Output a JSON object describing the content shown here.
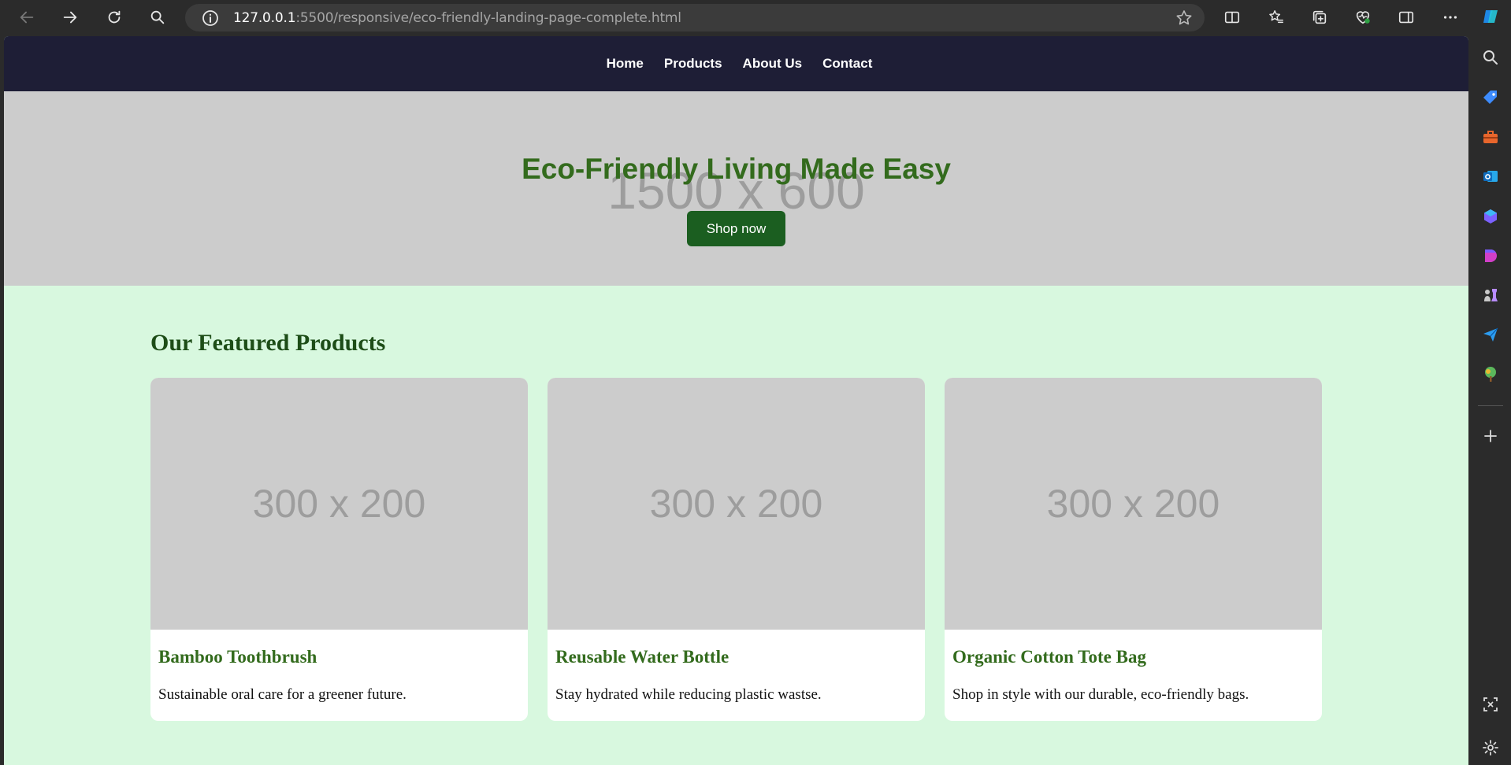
{
  "browser": {
    "url_host": "127.0.0.1",
    "url_rest": ":5500/responsive/eco-friendly-landing-page-complete.html"
  },
  "nav": {
    "items": [
      "Home",
      "Products",
      "About Us",
      "Contact"
    ]
  },
  "hero": {
    "placeholder": "1500 x 600",
    "title": "Eco-Friendly Living Made Easy",
    "button": "Shop now"
  },
  "featured": {
    "heading": "Our Featured Products",
    "products": [
      {
        "placeholder": "300 x 200",
        "name": "Bamboo Toothbrush",
        "description": "Sustainable oral care for a greener future."
      },
      {
        "placeholder": "300 x 200",
        "name": "Reusable Water Bottle",
        "description": "Stay hydrated while reducing plastic wastse."
      },
      {
        "placeholder": "300 x 200",
        "name": "Organic Cotton Tote Bag",
        "description": "Shop in style with our durable, eco-friendly bags."
      }
    ]
  },
  "colors": {
    "nav_bg": "#1e1e36",
    "hero_title": "#336b1d",
    "button_bg": "#1b5e20",
    "section_bg": "#d8f8df",
    "heading": "#1d4d17"
  }
}
